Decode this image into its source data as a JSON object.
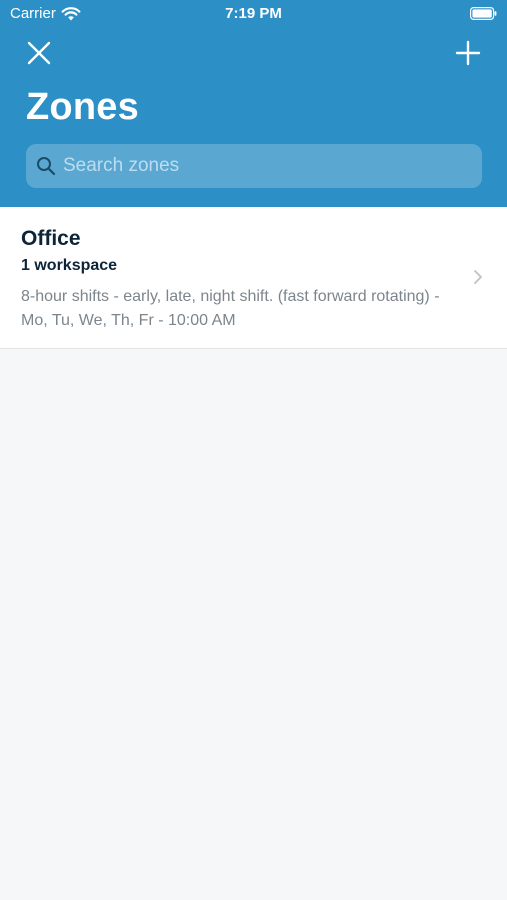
{
  "status_bar": {
    "carrier": "Carrier",
    "time": "7:19 PM"
  },
  "header": {
    "title": "Zones",
    "close_icon": "close-icon",
    "add_icon": "plus-icon",
    "background_color": "#2c8fc6"
  },
  "search": {
    "placeholder": "Search zones",
    "value": "",
    "icon": "search-icon"
  },
  "zones": [
    {
      "name": "Office",
      "subtitle": "1 workspace",
      "description": "8-hour shifts - early, late, night shift. (fast forward rotating) - Mo, Tu, We, Th, Fr - 10:00 AM"
    }
  ]
}
